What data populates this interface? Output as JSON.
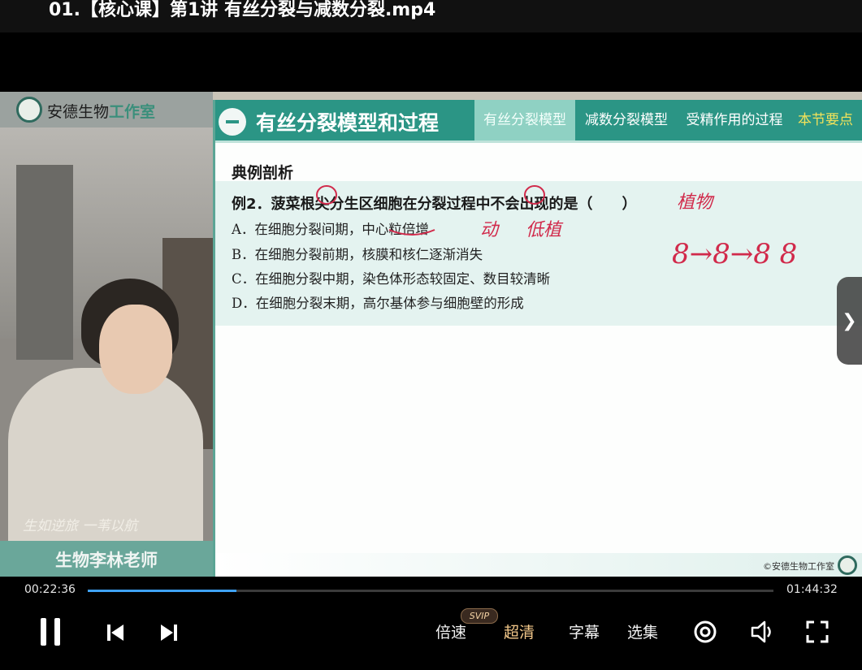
{
  "window": {
    "title": "01.【核心课】第1讲 有丝分裂与减数分裂.mp4"
  },
  "camera": {
    "logo_text": "安德生物",
    "logo_accent": "工作室",
    "signature": "生如逆旅 一苇以航",
    "teacher_name": "生物李林老师"
  },
  "slide": {
    "section_title": "有丝分裂模型和过程",
    "tabs": [
      {
        "label": "有丝分裂模型",
        "active": true
      },
      {
        "label": "减数分裂模型",
        "active": false
      },
      {
        "label": "受精作用的过程",
        "active": false
      },
      {
        "label": "本节要点",
        "active": false
      }
    ],
    "heading": "典例剖析",
    "question": "例2．菠菜根尖分生区细胞在分裂过程中不会出现的是（　　）",
    "options": [
      "A．在细胞分裂间期，中心粒倍增",
      "B．在细胞分裂前期，核膜和核仁逐渐消失",
      "C．在细胞分裂中期，染色体形态较固定、数目较清晰",
      "D．在细胞分裂末期，高尔基体参与细胞壁的形成"
    ],
    "annotations": {
      "near_answer": "植物",
      "after_option_a_1": "动",
      "after_option_a_2": "低植",
      "sequence": "8→8→8 8"
    },
    "copyright": "©安德生物工作室"
  },
  "player": {
    "current_time": "00:22:36",
    "total_time": "01:44:32",
    "progress_fraction": 0.217,
    "speed_label": "倍速",
    "svip_badge": "SVIP",
    "quality_label": "超清",
    "subtitle_label": "字幕",
    "episodes_label": "选集",
    "next_icon": "chevron-right-icon",
    "accent_color": "#3fa2f7"
  }
}
